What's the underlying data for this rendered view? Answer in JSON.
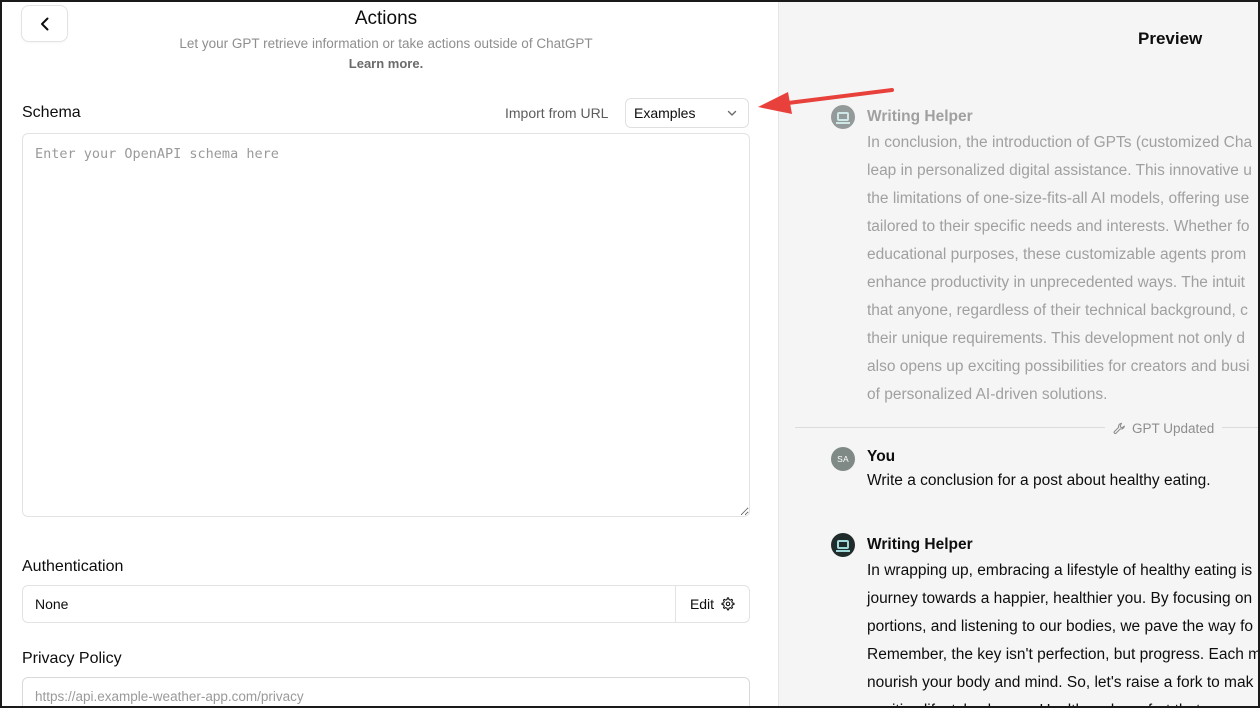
{
  "editor": {
    "title": "Actions",
    "subtitle": "Let your GPT retrieve information or take actions outside of ChatGPT",
    "learn_more": "Learn more.",
    "schema": {
      "label": "Schema",
      "import_from_url": "Import from URL",
      "examples_select": "Examples",
      "placeholder": "Enter your OpenAPI schema here",
      "value": ""
    },
    "authentication": {
      "label": "Authentication",
      "value": "None",
      "edit_label": "Edit"
    },
    "privacy_policy": {
      "label": "Privacy Policy",
      "placeholder": "https://api.example-weather-app.com/privacy",
      "value": ""
    }
  },
  "preview": {
    "title": "Preview",
    "gpt_updated": "GPT Updated",
    "messages": [
      {
        "author": "Writing Helper",
        "role": "bot",
        "faded": true,
        "lines": [
          "In conclusion, the introduction of GPTs (customized Cha",
          "leap in personalized digital assistance. This innovative u",
          "the limitations of one-size-fits-all AI models, offering use",
          "tailored to their specific needs and interests. Whether fo",
          "educational purposes, these customizable agents prom",
          "enhance productivity in unprecedented ways. The intuit",
          "that anyone, regardless of their technical background, c",
          "their unique requirements. This development not only d",
          "also opens up exciting possibilities for creators and busi",
          "of personalized AI-driven solutions."
        ]
      },
      {
        "author": "You",
        "role": "user",
        "initials": "SA",
        "lines": [
          "Write a conclusion for a post about healthy eating."
        ]
      },
      {
        "author": "Writing Helper",
        "role": "bot",
        "faded": false,
        "lines": [
          "In wrapping up, embracing a lifestyle of healthy eating is",
          "journey towards a happier, healthier you. By focusing on",
          "portions, and listening to our bodies, we pave the way fo",
          "Remember, the key isn't perfection, but progress. Each m",
          "nourish your body and mind. So, let's raise a fork to mak",
          "positive lifestyle change. Health and comfort that are"
        ]
      }
    ]
  },
  "colors": {
    "annotation_arrow": "#e8413c",
    "preview_bg": "#f5f5f5",
    "bot_avatar": "#202b2b",
    "user_avatar": "#7f8a86"
  },
  "icons": {
    "back": "chevron-left-icon",
    "examples_dropdown": "chevron-down-icon",
    "auth_edit": "gear-icon",
    "gpt_updated": "wrench-icon",
    "bot_avatar": "robot-avatar-icon"
  }
}
